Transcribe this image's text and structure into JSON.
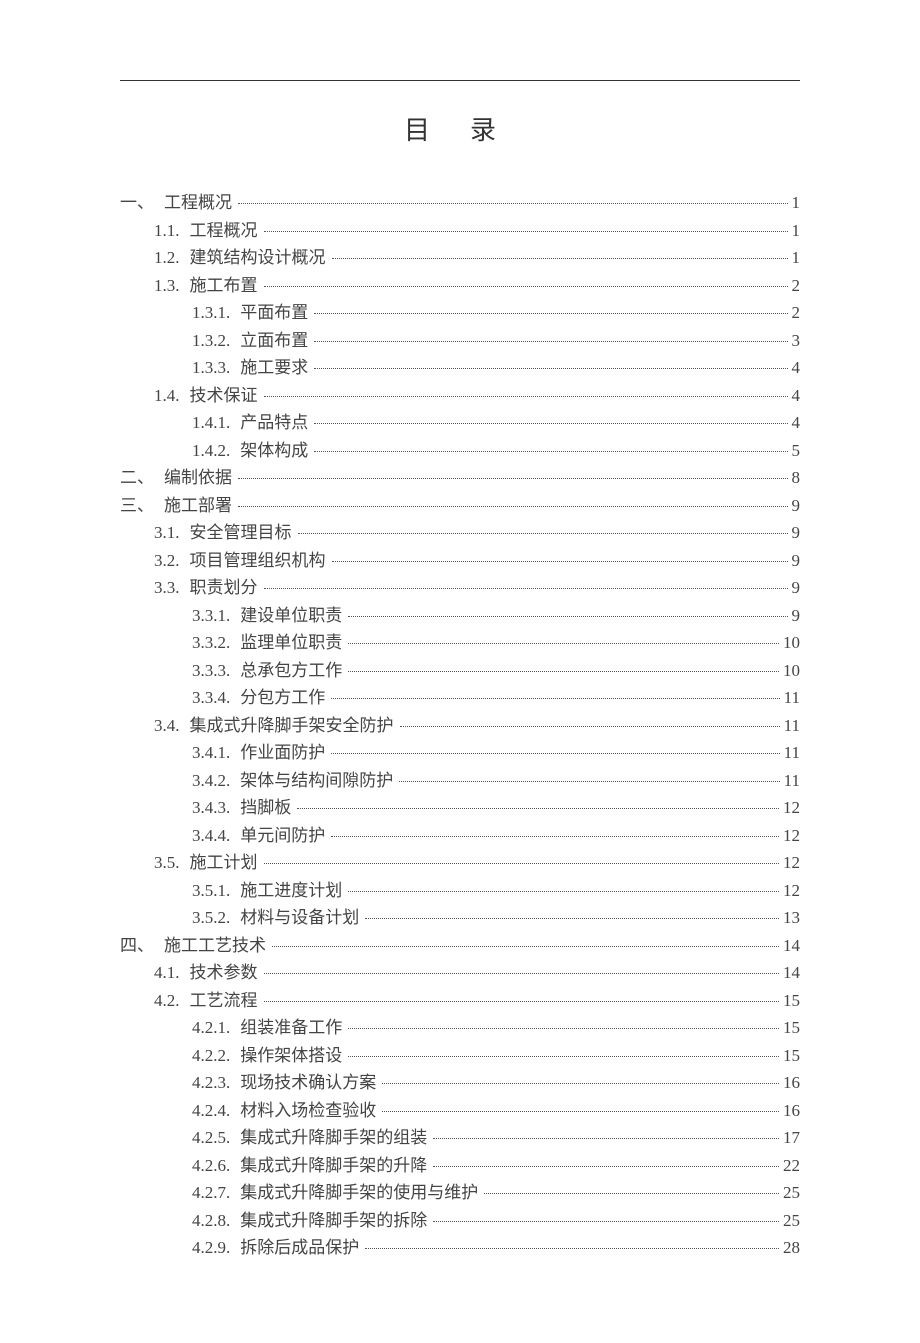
{
  "title": "目录",
  "toc": [
    {
      "level": 0,
      "num": "一、",
      "label": "工程概况",
      "page": "1"
    },
    {
      "level": 1,
      "num": "1.1.",
      "label": "工程概况",
      "page": "1"
    },
    {
      "level": 1,
      "num": "1.2.",
      "label": "建筑结构设计概况",
      "page": "1"
    },
    {
      "level": 1,
      "num": "1.3.",
      "label": "施工布置",
      "page": "2"
    },
    {
      "level": 2,
      "num": "1.3.1.",
      "label": "平面布置",
      "page": "2"
    },
    {
      "level": 2,
      "num": "1.3.2.",
      "label": "立面布置",
      "page": "3"
    },
    {
      "level": 2,
      "num": "1.3.3.",
      "label": "施工要求",
      "page": "4"
    },
    {
      "level": 1,
      "num": "1.4.",
      "label": "技术保证",
      "page": "4"
    },
    {
      "level": 2,
      "num": "1.4.1.",
      "label": "产品特点",
      "page": "4"
    },
    {
      "level": 2,
      "num": "1.4.2.",
      "label": "架体构成",
      "page": "5"
    },
    {
      "level": 0,
      "num": "二、",
      "label": "编制依据",
      "page": "8"
    },
    {
      "level": 0,
      "num": "三、",
      "label": "施工部署",
      "page": "9"
    },
    {
      "level": 1,
      "num": "3.1.",
      "label": "安全管理目标",
      "page": "9"
    },
    {
      "level": 1,
      "num": "3.2.",
      "label": "项目管理组织机构",
      "page": "9"
    },
    {
      "level": 1,
      "num": "3.3.",
      "label": "职责划分",
      "page": "9"
    },
    {
      "level": 2,
      "num": "3.3.1.",
      "label": "建设单位职责",
      "page": "9"
    },
    {
      "level": 2,
      "num": "3.3.2.",
      "label": "监理单位职责",
      "page": "10"
    },
    {
      "level": 2,
      "num": "3.3.3.",
      "label": "总承包方工作",
      "page": "10"
    },
    {
      "level": 2,
      "num": "3.3.4.",
      "label": "分包方工作",
      "page": "11"
    },
    {
      "level": 1,
      "num": "3.4.",
      "label": "集成式升降脚手架安全防护",
      "page": "11"
    },
    {
      "level": 2,
      "num": "3.4.1.",
      "label": "作业面防护",
      "page": "11"
    },
    {
      "level": 2,
      "num": "3.4.2.",
      "label": "架体与结构间隙防护",
      "page": "11"
    },
    {
      "level": 2,
      "num": "3.4.3.",
      "label": "挡脚板",
      "page": "12"
    },
    {
      "level": 2,
      "num": "3.4.4.",
      "label": "单元间防护",
      "page": "12"
    },
    {
      "level": 1,
      "num": "3.5.",
      "label": "施工计划",
      "page": "12"
    },
    {
      "level": 2,
      "num": "3.5.1.",
      "label": "施工进度计划",
      "page": "12"
    },
    {
      "level": 2,
      "num": "3.5.2.",
      "label": "材料与设备计划",
      "page": "13"
    },
    {
      "level": 0,
      "num": "四、",
      "label": "施工工艺技术",
      "page": "14"
    },
    {
      "level": 1,
      "num": "4.1.",
      "label": "技术参数",
      "page": "14"
    },
    {
      "level": 1,
      "num": "4.2.",
      "label": "工艺流程",
      "page": "15"
    },
    {
      "level": 2,
      "num": "4.2.1.",
      "label": "组装准备工作",
      "page": "15"
    },
    {
      "level": 2,
      "num": "4.2.2.",
      "label": "操作架体搭设",
      "page": "15"
    },
    {
      "level": 2,
      "num": "4.2.3.",
      "label": "现场技术确认方案",
      "page": "16"
    },
    {
      "level": 2,
      "num": "4.2.4.",
      "label": "材料入场检查验收",
      "page": "16"
    },
    {
      "level": 2,
      "num": "4.2.5.",
      "label": "集成式升降脚手架的组装",
      "page": "17"
    },
    {
      "level": 2,
      "num": "4.2.6.",
      "label": "集成式升降脚手架的升降",
      "page": "22"
    },
    {
      "level": 2,
      "num": "4.2.7.",
      "label": "集成式升降脚手架的使用与维护",
      "page": "25"
    },
    {
      "level": 2,
      "num": "4.2.8.",
      "label": "集成式升降脚手架的拆除",
      "page": "25"
    },
    {
      "level": 2,
      "num": "4.2.9.",
      "label": "拆除后成品保护",
      "page": "28"
    }
  ]
}
